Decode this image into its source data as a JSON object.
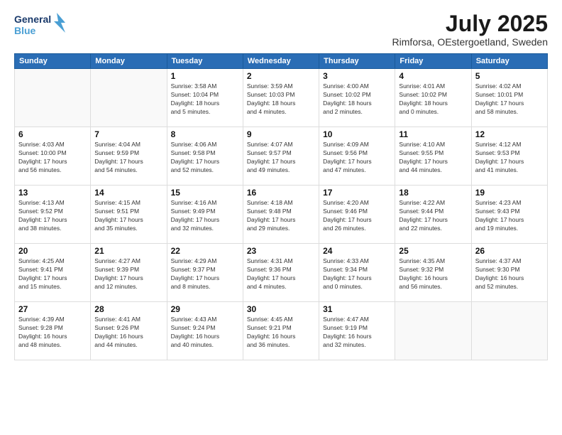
{
  "logo": {
    "line1": "General",
    "line2": "Blue"
  },
  "title": "July 2025",
  "subtitle": "Rimforsa, OEstergoetland, Sweden",
  "days_header": [
    "Sunday",
    "Monday",
    "Tuesday",
    "Wednesday",
    "Thursday",
    "Friday",
    "Saturday"
  ],
  "weeks": [
    [
      {
        "day": "",
        "info": ""
      },
      {
        "day": "",
        "info": ""
      },
      {
        "day": "1",
        "info": "Sunrise: 3:58 AM\nSunset: 10:04 PM\nDaylight: 18 hours\nand 5 minutes."
      },
      {
        "day": "2",
        "info": "Sunrise: 3:59 AM\nSunset: 10:03 PM\nDaylight: 18 hours\nand 4 minutes."
      },
      {
        "day": "3",
        "info": "Sunrise: 4:00 AM\nSunset: 10:02 PM\nDaylight: 18 hours\nand 2 minutes."
      },
      {
        "day": "4",
        "info": "Sunrise: 4:01 AM\nSunset: 10:02 PM\nDaylight: 18 hours\nand 0 minutes."
      },
      {
        "day": "5",
        "info": "Sunrise: 4:02 AM\nSunset: 10:01 PM\nDaylight: 17 hours\nand 58 minutes."
      }
    ],
    [
      {
        "day": "6",
        "info": "Sunrise: 4:03 AM\nSunset: 10:00 PM\nDaylight: 17 hours\nand 56 minutes."
      },
      {
        "day": "7",
        "info": "Sunrise: 4:04 AM\nSunset: 9:59 PM\nDaylight: 17 hours\nand 54 minutes."
      },
      {
        "day": "8",
        "info": "Sunrise: 4:06 AM\nSunset: 9:58 PM\nDaylight: 17 hours\nand 52 minutes."
      },
      {
        "day": "9",
        "info": "Sunrise: 4:07 AM\nSunset: 9:57 PM\nDaylight: 17 hours\nand 49 minutes."
      },
      {
        "day": "10",
        "info": "Sunrise: 4:09 AM\nSunset: 9:56 PM\nDaylight: 17 hours\nand 47 minutes."
      },
      {
        "day": "11",
        "info": "Sunrise: 4:10 AM\nSunset: 9:55 PM\nDaylight: 17 hours\nand 44 minutes."
      },
      {
        "day": "12",
        "info": "Sunrise: 4:12 AM\nSunset: 9:53 PM\nDaylight: 17 hours\nand 41 minutes."
      }
    ],
    [
      {
        "day": "13",
        "info": "Sunrise: 4:13 AM\nSunset: 9:52 PM\nDaylight: 17 hours\nand 38 minutes."
      },
      {
        "day": "14",
        "info": "Sunrise: 4:15 AM\nSunset: 9:51 PM\nDaylight: 17 hours\nand 35 minutes."
      },
      {
        "day": "15",
        "info": "Sunrise: 4:16 AM\nSunset: 9:49 PM\nDaylight: 17 hours\nand 32 minutes."
      },
      {
        "day": "16",
        "info": "Sunrise: 4:18 AM\nSunset: 9:48 PM\nDaylight: 17 hours\nand 29 minutes."
      },
      {
        "day": "17",
        "info": "Sunrise: 4:20 AM\nSunset: 9:46 PM\nDaylight: 17 hours\nand 26 minutes."
      },
      {
        "day": "18",
        "info": "Sunrise: 4:22 AM\nSunset: 9:44 PM\nDaylight: 17 hours\nand 22 minutes."
      },
      {
        "day": "19",
        "info": "Sunrise: 4:23 AM\nSunset: 9:43 PM\nDaylight: 17 hours\nand 19 minutes."
      }
    ],
    [
      {
        "day": "20",
        "info": "Sunrise: 4:25 AM\nSunset: 9:41 PM\nDaylight: 17 hours\nand 15 minutes."
      },
      {
        "day": "21",
        "info": "Sunrise: 4:27 AM\nSunset: 9:39 PM\nDaylight: 17 hours\nand 12 minutes."
      },
      {
        "day": "22",
        "info": "Sunrise: 4:29 AM\nSunset: 9:37 PM\nDaylight: 17 hours\nand 8 minutes."
      },
      {
        "day": "23",
        "info": "Sunrise: 4:31 AM\nSunset: 9:36 PM\nDaylight: 17 hours\nand 4 minutes."
      },
      {
        "day": "24",
        "info": "Sunrise: 4:33 AM\nSunset: 9:34 PM\nDaylight: 17 hours\nand 0 minutes."
      },
      {
        "day": "25",
        "info": "Sunrise: 4:35 AM\nSunset: 9:32 PM\nDaylight: 16 hours\nand 56 minutes."
      },
      {
        "day": "26",
        "info": "Sunrise: 4:37 AM\nSunset: 9:30 PM\nDaylight: 16 hours\nand 52 minutes."
      }
    ],
    [
      {
        "day": "27",
        "info": "Sunrise: 4:39 AM\nSunset: 9:28 PM\nDaylight: 16 hours\nand 48 minutes."
      },
      {
        "day": "28",
        "info": "Sunrise: 4:41 AM\nSunset: 9:26 PM\nDaylight: 16 hours\nand 44 minutes."
      },
      {
        "day": "29",
        "info": "Sunrise: 4:43 AM\nSunset: 9:24 PM\nDaylight: 16 hours\nand 40 minutes."
      },
      {
        "day": "30",
        "info": "Sunrise: 4:45 AM\nSunset: 9:21 PM\nDaylight: 16 hours\nand 36 minutes."
      },
      {
        "day": "31",
        "info": "Sunrise: 4:47 AM\nSunset: 9:19 PM\nDaylight: 16 hours\nand 32 minutes."
      },
      {
        "day": "",
        "info": ""
      },
      {
        "day": "",
        "info": ""
      }
    ]
  ]
}
